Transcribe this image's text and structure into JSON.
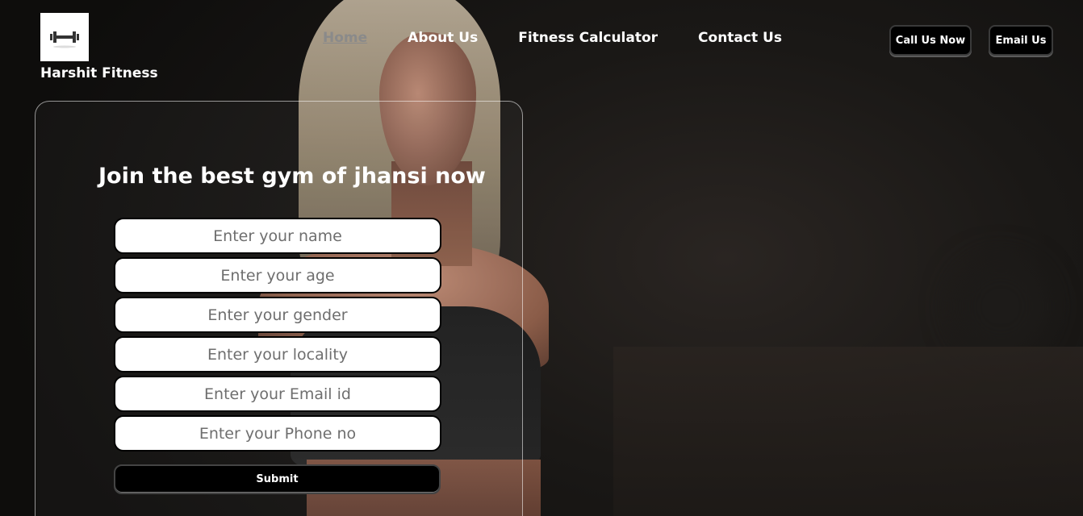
{
  "header": {
    "logo_icon": "dumbbell-icon",
    "brand": "Harshit Fitness",
    "nav": [
      {
        "label": "Home",
        "active": true
      },
      {
        "label": "About Us",
        "active": false
      },
      {
        "label": "Fitness Calculator",
        "active": false
      },
      {
        "label": "Contact Us",
        "active": false
      }
    ],
    "call_button": "Call Us Now",
    "email_button": "Email Us"
  },
  "form": {
    "title": "Join the best gym of jhansi now",
    "fields": [
      {
        "placeholder": "Enter your name"
      },
      {
        "placeholder": "Enter your age"
      },
      {
        "placeholder": "Enter your gender"
      },
      {
        "placeholder": "Enter your locality"
      },
      {
        "placeholder": "Enter your Email id"
      },
      {
        "placeholder": "Enter your Phone no"
      }
    ],
    "submit_label": "Submit"
  },
  "colors": {
    "background": "#141414",
    "button_bg": "#000000",
    "active_nav": "#8a8a8a"
  }
}
